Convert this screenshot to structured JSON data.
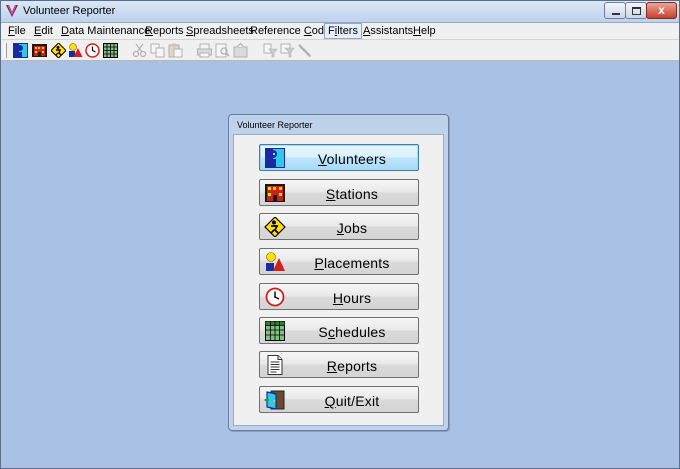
{
  "window": {
    "title": "Volunteer Reporter",
    "close_glyph": "x"
  },
  "menu": [
    {
      "label": "File",
      "mnemonic": "F",
      "rest": "ile"
    },
    {
      "label": "Edit",
      "mnemonic": "E",
      "rest": "dit"
    },
    {
      "label": "Data Maintenance",
      "mnemonic": "D",
      "rest": "ata Maintenance"
    },
    {
      "label": "Reports",
      "mnemonic": "R",
      "rest": "eports"
    },
    {
      "label": "Spreadsheets",
      "mnemonic": "S",
      "rest": "preadsheets"
    },
    {
      "label": "Reference Codes",
      "pre": "Reference ",
      "mnemonic": "C",
      "rest": "odes"
    },
    {
      "label": "Filters",
      "pre": "F",
      "mnemonic": "i",
      "rest": "lters",
      "active": true
    },
    {
      "label": "Assistants",
      "mnemonic": "A",
      "rest": "ssistants"
    },
    {
      "label": "Help",
      "mnemonic": "H",
      "rest": "elp"
    }
  ],
  "toolbar": [
    {
      "icon": "volunteers-icon",
      "enabled": true
    },
    {
      "icon": "stations-icon",
      "enabled": true
    },
    {
      "icon": "jobs-icon",
      "enabled": true
    },
    {
      "icon": "placements-icon",
      "enabled": true
    },
    {
      "icon": "hours-icon",
      "enabled": true
    },
    {
      "icon": "schedules-icon",
      "enabled": true
    },
    {
      "icon": "cut-icon",
      "enabled": false
    },
    {
      "icon": "copy-icon",
      "enabled": false
    },
    {
      "icon": "paste-icon",
      "enabled": false
    },
    {
      "icon": "print-icon",
      "enabled": false
    },
    {
      "icon": "print-preview-icon",
      "enabled": false
    },
    {
      "icon": "export-icon",
      "enabled": false
    },
    {
      "icon": "filter-icon",
      "enabled": false
    },
    {
      "icon": "filter-clear-icon",
      "enabled": false
    },
    {
      "icon": "pen-icon",
      "enabled": false
    }
  ],
  "dialog": {
    "title": "Volunteer Reporter",
    "buttons": [
      {
        "label": "Volunteers",
        "mnemonic": "V",
        "rest": "olunteers",
        "icon": "volunteers-icon",
        "focused": true
      },
      {
        "label": "Stations",
        "mnemonic": "S",
        "rest": "tations",
        "icon": "stations-icon"
      },
      {
        "label": "Jobs",
        "mnemonic": "J",
        "rest": "obs",
        "icon": "jobs-icon"
      },
      {
        "label": "Placements",
        "mnemonic": "P",
        "rest": "lacements",
        "icon": "placements-icon"
      },
      {
        "label": "Hours",
        "mnemonic": "H",
        "rest": "ours",
        "icon": "hours-icon"
      },
      {
        "label": "Schedules",
        "pre": "S",
        "mnemonic": "c",
        "rest": "hedules",
        "icon": "schedules-icon"
      },
      {
        "label": "Reports",
        "mnemonic": "R",
        "rest": "eports",
        "icon": "reports-icon"
      },
      {
        "label": "Quit/Exit",
        "mnemonic": "Q",
        "rest": "uit/Exit",
        "icon": "quit-exit-icon"
      }
    ]
  },
  "colors": {
    "desktop": "#a9c1e4",
    "focus_border": "#3c7fb1"
  }
}
